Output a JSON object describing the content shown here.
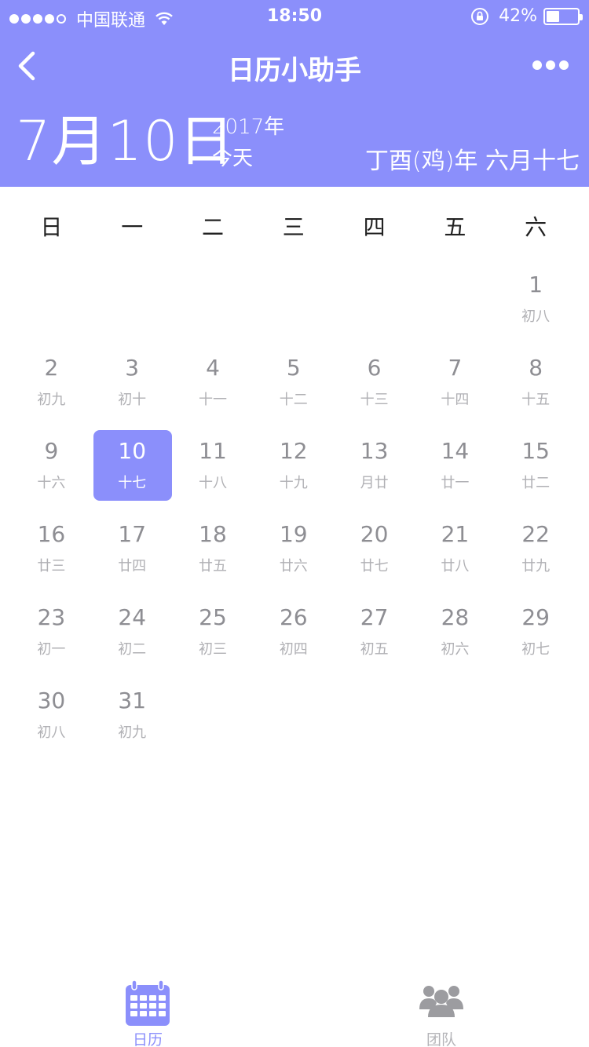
{
  "status_bar": {
    "carrier": "中国联通",
    "time": "18:50",
    "battery": "42%",
    "battery_level": 0.42
  },
  "nav": {
    "title": "日历小助手"
  },
  "today": {
    "date": "7月10日",
    "year": "2017年",
    "label": "今天",
    "lunar": "丁酉(鸡)年 六月十七"
  },
  "weekdays": [
    "日",
    "一",
    "二",
    "三",
    "四",
    "五",
    "六"
  ],
  "weeks": [
    [
      null,
      null,
      null,
      null,
      null,
      null,
      {
        "day": "1",
        "lunar": "初八"
      }
    ],
    [
      {
        "day": "2",
        "lunar": "初九"
      },
      {
        "day": "3",
        "lunar": "初十"
      },
      {
        "day": "4",
        "lunar": "十一"
      },
      {
        "day": "5",
        "lunar": "十二"
      },
      {
        "day": "6",
        "lunar": "十三"
      },
      {
        "day": "7",
        "lunar": "十四"
      },
      {
        "day": "8",
        "lunar": "十五"
      }
    ],
    [
      {
        "day": "9",
        "lunar": "十六"
      },
      {
        "day": "10",
        "lunar": "十七",
        "selected": true
      },
      {
        "day": "11",
        "lunar": "十八"
      },
      {
        "day": "12",
        "lunar": "十九"
      },
      {
        "day": "13",
        "lunar": "月廿"
      },
      {
        "day": "14",
        "lunar": "廿一"
      },
      {
        "day": "15",
        "lunar": "廿二"
      }
    ],
    [
      {
        "day": "16",
        "lunar": "廿三"
      },
      {
        "day": "17",
        "lunar": "廿四"
      },
      {
        "day": "18",
        "lunar": "廿五"
      },
      {
        "day": "19",
        "lunar": "廿六"
      },
      {
        "day": "20",
        "lunar": "廿七"
      },
      {
        "day": "21",
        "lunar": "廿八"
      },
      {
        "day": "22",
        "lunar": "廿九"
      }
    ],
    [
      {
        "day": "23",
        "lunar": "初一"
      },
      {
        "day": "24",
        "lunar": "初二"
      },
      {
        "day": "25",
        "lunar": "初三"
      },
      {
        "day": "26",
        "lunar": "初四"
      },
      {
        "day": "27",
        "lunar": "初五"
      },
      {
        "day": "28",
        "lunar": "初六"
      },
      {
        "day": "29",
        "lunar": "初七"
      }
    ],
    [
      {
        "day": "30",
        "lunar": "初八"
      },
      {
        "day": "31",
        "lunar": "初九"
      },
      null,
      null,
      null,
      null,
      null
    ]
  ],
  "tabs": [
    {
      "label": "日历",
      "icon": "calendar-icon",
      "active": true
    },
    {
      "label": "团队",
      "icon": "team-icon",
      "active": false
    }
  ],
  "colors": {
    "accent": "#8b8ffb",
    "day_text": "#8e8e93",
    "lunar_text": "#b0b0b4",
    "inactive_tab": "#b4b4b8"
  }
}
